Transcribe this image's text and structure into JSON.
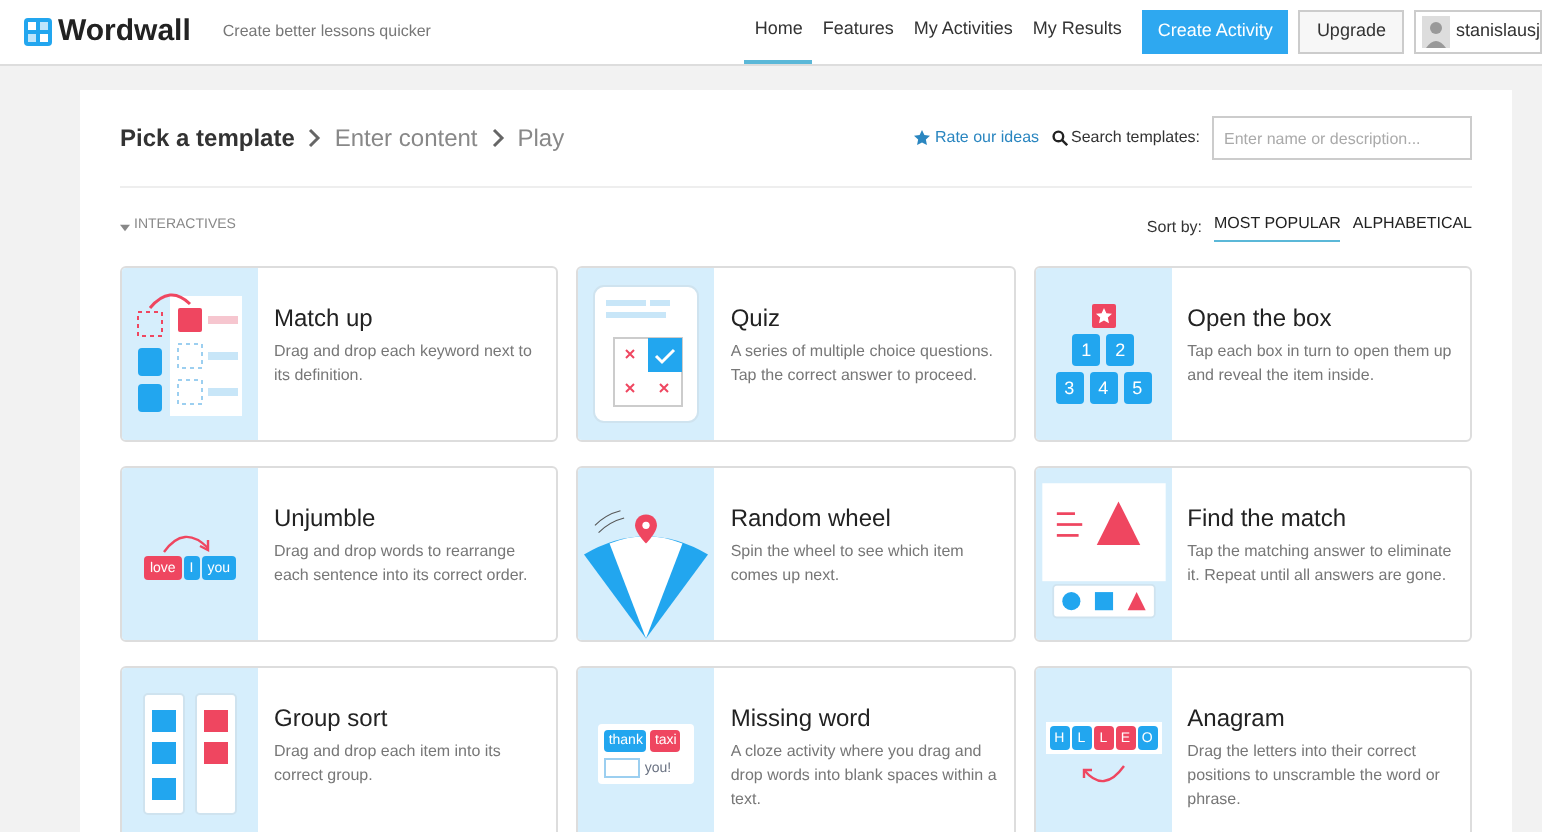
{
  "header": {
    "logo": "Wordwall",
    "tagline": "Create better lessons quicker",
    "nav": [
      {
        "label": "Home",
        "selected": true
      },
      {
        "label": "Features",
        "selected": false
      },
      {
        "label": "My Activities",
        "selected": false
      },
      {
        "label": "My Results",
        "selected": false
      }
    ],
    "create_button": "Create Activity",
    "upgrade_button": "Upgrade",
    "user": "stanislausj"
  },
  "breadcrumb": [
    {
      "label": "Pick a template",
      "selected": true
    },
    {
      "label": "Enter content",
      "selected": false
    },
    {
      "label": "Play",
      "selected": false
    }
  ],
  "rate_link": "Rate our ideas",
  "search": {
    "label": "Search templates:",
    "placeholder": "Enter name or description..."
  },
  "section": "INTERACTIVES",
  "sort": {
    "label": "Sort by:",
    "options": [
      {
        "label": "MOST POPULAR",
        "selected": true
      },
      {
        "label": "ALPHABETICAL",
        "selected": false
      }
    ]
  },
  "templates": [
    {
      "kind": "match-up",
      "title": "Match up",
      "description": "Drag and drop each keyword next to its definition."
    },
    {
      "kind": "quiz",
      "title": "Quiz",
      "description": "A series of multiple choice questions. Tap the correct answer to proceed."
    },
    {
      "kind": "open-box",
      "title": "Open the box",
      "description": "Tap each box in turn to open them up and reveal the item inside.",
      "tiles": [
        {
          "text": "1",
          "color": "#22a6ef"
        },
        {
          "text": "2",
          "color": "#22a6ef"
        },
        {
          "text": "3",
          "color": "#22a6ef"
        },
        {
          "text": "4",
          "color": "#22a6ef"
        },
        {
          "text": "5",
          "color": "#22a6ef"
        }
      ]
    },
    {
      "kind": "unjumble",
      "title": "Unjumble",
      "description": "Drag and drop words to rearrange each sentence into its correct order.",
      "tiles": [
        {
          "text": "love",
          "color": "#ef4660"
        },
        {
          "text": "I",
          "color": "#22a6ef"
        },
        {
          "text": "you",
          "color": "#22a6ef"
        }
      ]
    },
    {
      "kind": "wheel",
      "title": "Random wheel",
      "description": "Spin the wheel to see which item comes up next."
    },
    {
      "kind": "find-match",
      "title": "Find the match",
      "description": "Tap the matching answer to eliminate it. Repeat until all answers are gone."
    },
    {
      "kind": "group-sort",
      "title": "Group sort",
      "description": "Drag and drop each item into its correct group."
    },
    {
      "kind": "missing-word",
      "title": "Missing word",
      "description": "A cloze activity where you drag and drop words into blank spaces within a text.",
      "tiles": [
        {
          "text": "thank",
          "color": "#22a6ef"
        },
        {
          "text": "taxi",
          "color": "#ef4660"
        },
        {
          "text": "you!",
          "color": "#ffffff"
        }
      ]
    },
    {
      "kind": "anagram",
      "title": "Anagram",
      "description": "Drag the letters into their correct positions to unscramble the word or phrase.",
      "tiles": [
        {
          "text": "H",
          "color": "#22a6ef"
        },
        {
          "text": "L",
          "color": "#22a6ef"
        },
        {
          "text": "L",
          "color": "#ef4660"
        },
        {
          "text": "E",
          "color": "#ef4660"
        },
        {
          "text": "O",
          "color": "#22a6ef"
        }
      ]
    }
  ]
}
